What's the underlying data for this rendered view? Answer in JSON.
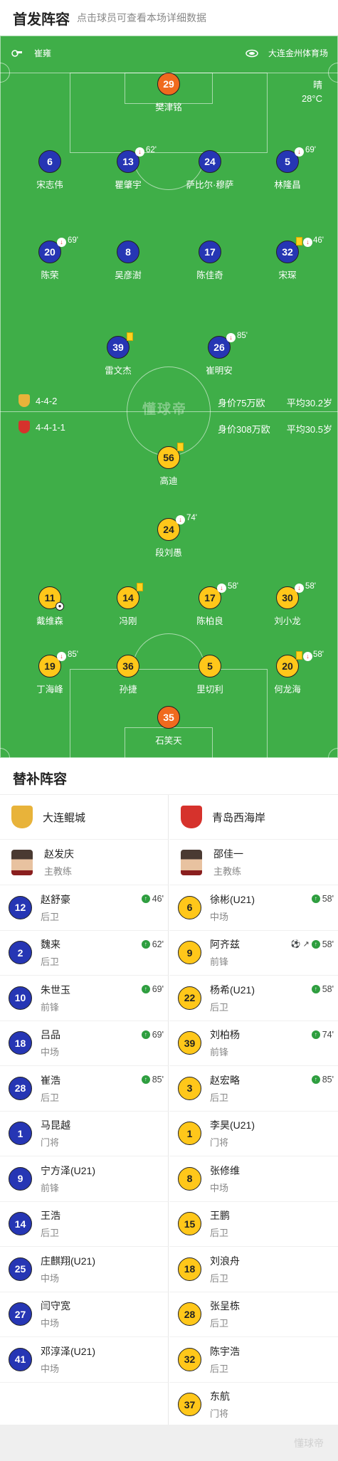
{
  "header": {
    "title": "首发阵容",
    "subtitle": "点击球员可查看本场详细数据"
  },
  "info": {
    "referee": "崔雍",
    "venue": "大连金州体育场",
    "weather": "晴",
    "temperature": "28°C"
  },
  "pitch_watermark": "懂球帝",
  "formations": {
    "home": {
      "formation": "4-4-2",
      "value": "身价75万欧",
      "avg_age": "平均30.2岁"
    },
    "away": {
      "formation": "4-4-1-1",
      "value": "身价308万欧",
      "avg_age": "平均30.5岁"
    }
  },
  "home_lineup": [
    {
      "number": "29",
      "name": "樊津铭",
      "sub_minute": "",
      "yellow": false
    },
    {
      "number": "6",
      "name": "宋志伟",
      "sub_minute": "",
      "yellow": false
    },
    {
      "number": "13",
      "name": "瞿肇宇",
      "sub_minute": "62'",
      "yellow": false
    },
    {
      "number": "24",
      "name": "萨比尔·穆萨",
      "sub_minute": "",
      "yellow": false
    },
    {
      "number": "5",
      "name": "林隆昌",
      "sub_minute": "69'",
      "yellow": false
    },
    {
      "number": "20",
      "name": "陈荣",
      "sub_minute": "69'",
      "yellow": false
    },
    {
      "number": "8",
      "name": "吴彦澍",
      "sub_minute": "",
      "yellow": false
    },
    {
      "number": "17",
      "name": "陈佳奇",
      "sub_minute": "",
      "yellow": false
    },
    {
      "number": "32",
      "name": "宋琛",
      "sub_minute": "46'",
      "yellow": true
    },
    {
      "number": "39",
      "name": "雷文杰",
      "sub_minute": "",
      "yellow": true
    },
    {
      "number": "26",
      "name": "崔明安",
      "sub_minute": "85'",
      "yellow": false
    }
  ],
  "away_lineup": [
    {
      "number": "56",
      "name": "高迪",
      "sub_minute": "",
      "yellow": true
    },
    {
      "number": "24",
      "name": "段刘愚",
      "sub_minute": "74'",
      "yellow": false
    },
    {
      "number": "11",
      "name": "戴维森",
      "sub_minute": "",
      "yellow": false
    },
    {
      "number": "14",
      "name": "冯刚",
      "sub_minute": "",
      "yellow": true
    },
    {
      "number": "17",
      "name": "陈柏良",
      "sub_minute": "58'",
      "yellow": false
    },
    {
      "number": "30",
      "name": "刘小龙",
      "sub_minute": "58'",
      "yellow": false
    },
    {
      "number": "19",
      "name": "丁海峰",
      "sub_minute": "85'",
      "yellow": false
    },
    {
      "number": "36",
      "name": "孙捷",
      "sub_minute": "",
      "yellow": false
    },
    {
      "number": "5",
      "name": "里切利",
      "sub_minute": "",
      "yellow": false
    },
    {
      "number": "20",
      "name": "何龙海",
      "sub_minute": "58'",
      "yellow": true
    },
    {
      "number": "35",
      "name": "石笑天",
      "sub_minute": "",
      "yellow": false
    }
  ],
  "subs_title": "替补阵容",
  "home_team": {
    "name": "大连鲲城",
    "coach": "赵发庆",
    "coach_role": "主教练"
  },
  "away_team": {
    "name": "青岛西海岸",
    "coach": "邵佳一",
    "coach_role": "主教练"
  },
  "home_subs": [
    {
      "number": "12",
      "name": "赵舒豪",
      "position": "后卫",
      "in_minute": "46'"
    },
    {
      "number": "2",
      "name": "魏来",
      "position": "后卫",
      "in_minute": "62'"
    },
    {
      "number": "10",
      "name": "朱世玉",
      "position": "前锋",
      "in_minute": "69'"
    },
    {
      "number": "18",
      "name": "吕品",
      "position": "中场",
      "in_minute": "69'"
    },
    {
      "number": "28",
      "name": "崔浩",
      "position": "后卫",
      "in_minute": "85'"
    },
    {
      "number": "1",
      "name": "马昆越",
      "position": "门将",
      "in_minute": ""
    },
    {
      "number": "9",
      "name": "宁方泽(U21)",
      "position": "前锋",
      "in_minute": ""
    },
    {
      "number": "14",
      "name": "王浩",
      "position": "后卫",
      "in_minute": ""
    },
    {
      "number": "25",
      "name": "庄麒翔(U21)",
      "position": "中场",
      "in_minute": ""
    },
    {
      "number": "27",
      "name": "闫守宽",
      "position": "中场",
      "in_minute": ""
    },
    {
      "number": "41",
      "name": "邓淳泽(U21)",
      "position": "中场",
      "in_minute": ""
    }
  ],
  "away_subs": [
    {
      "number": "6",
      "name": "徐彬(U21)",
      "position": "中场",
      "in_minute": "58'"
    },
    {
      "number": "9",
      "name": "阿齐兹",
      "position": "前锋",
      "in_minute": "58'"
    },
    {
      "number": "22",
      "name": "杨希(U21)",
      "position": "后卫",
      "in_minute": "58'"
    },
    {
      "number": "39",
      "name": "刘柏杨",
      "position": "前锋",
      "in_minute": "74'"
    },
    {
      "number": "3",
      "name": "赵宏略",
      "position": "后卫",
      "in_minute": "85'"
    },
    {
      "number": "1",
      "name": "李昊(U21)",
      "position": "门将",
      "in_minute": ""
    },
    {
      "number": "8",
      "name": "张修维",
      "position": "中场",
      "in_minute": ""
    },
    {
      "number": "15",
      "name": "王鹏",
      "position": "后卫",
      "in_minute": ""
    },
    {
      "number": "18",
      "name": "刘浪舟",
      "position": "后卫",
      "in_minute": ""
    },
    {
      "number": "28",
      "name": "张呈栋",
      "position": "后卫",
      "in_minute": ""
    },
    {
      "number": "32",
      "name": "陈宇浩",
      "position": "后卫",
      "in_minute": ""
    },
    {
      "number": "37",
      "name": "东航",
      "position": "门将",
      "in_minute": ""
    }
  ],
  "colors": {
    "pitch": "#3fae48",
    "home": "#2636b4",
    "away": "#ffc71a",
    "goalkeeper": "#f06a1e",
    "sub_in": "#2e9e3f"
  }
}
